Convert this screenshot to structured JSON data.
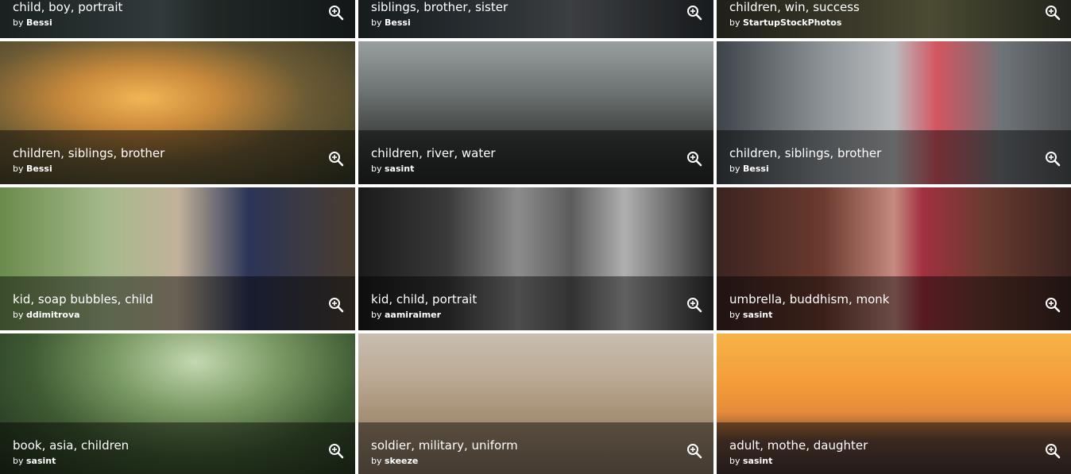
{
  "gallery": {
    "tiles": [
      {
        "tags": "child, boy, portrait",
        "by": "by ",
        "author": "Bessi",
        "bg": "linear-gradient(90deg,#2f3b3a 0%,#5b6a6d 45%,#3b4745 60%,#222b2d 100%)"
      },
      {
        "tags": "siblings, brother, sister",
        "by": "by ",
        "author": "Bessi",
        "bg": "linear-gradient(90deg,#2a3238 0%,#4f5a60 40%,#6e7377 60%,#2c3135 100%)"
      },
      {
        "tags": "children, win, success",
        "by": "by ",
        "author": "StartupStockPhotos",
        "bg": "linear-gradient(90deg,#3b3a2e 0%,#6c6a4d 40%,#8a8a5c 60%,#3c4033 100%)"
      },
      {
        "tags": "children, siblings, brother",
        "by": "by ",
        "author": "Bessi",
        "bg": "radial-gradient(ellipse at 40% 40%,#f3b655 0%,#c98a3c 25%,#6b5a34 55%,#2f3424 100%)"
      },
      {
        "tags": "children, river, water",
        "by": "by ",
        "author": "sasint",
        "bg": "linear-gradient(180deg,#9aa0a0 0%,#6d7372 35%,#3a3e3c 70%,#232624 100%)"
      },
      {
        "tags": "children, siblings, brother",
        "by": "by ",
        "author": "Bessi",
        "bg": "linear-gradient(90deg,#3d4348 0%,#8c9296 30%,#b9bcbf 50%,#d35560 62%,#6f7478 80%,#4b4f52 100%)"
      },
      {
        "tags": "kid, soap bubbles, child",
        "by": "by ",
        "author": "ddimitrova",
        "bg": "linear-gradient(90deg,#6a8b4c 0%,#a6b98b 30%,#c2b29a 50%,#2b3557 70%,#4a3d30 100%)"
      },
      {
        "tags": "kid, child, portrait",
        "by": "by ",
        "author": "aamiraimer",
        "bg": "linear-gradient(90deg,#1a1a1a 0%,#3a3a3a 25%,#8c8c8c 45%,#5c5c5c 60%,#b0b0b0 75%,#2e2e2e 100%)"
      },
      {
        "tags": "umbrella, buddhism, monk",
        "by": "by ",
        "author": "sasint",
        "bg": "linear-gradient(90deg,#3b2420 0%,#6b3a2e 30%,#c58a80 50%,#a23040 58%,#6a3b30 75%,#3a2420 100%)"
      },
      {
        "tags": "book, asia, children",
        "by": "by ",
        "author": "sasint",
        "bg": "radial-gradient(ellipse at 55% 20%,#c4d8b2 0%,#7a9a63 30%,#3e5a33 60%,#1e2a1a 100%)"
      },
      {
        "tags": "soldier, military, uniform",
        "by": "by ",
        "author": "skeeze",
        "bg": "linear-gradient(180deg,#c9bdb0 0%,#bcaa95 30%,#a48e74 60%,#7b6a58 100%)"
      },
      {
        "tags": "adult, mothe, daughter",
        "by": "by ",
        "author": "sasint",
        "bg": "linear-gradient(180deg,#f6b347 0%,#f39c3a 35%,#e58b3a 55%,#6a4a3a 75%,#3c3030 100%)"
      }
    ]
  },
  "icons": {
    "zoom": "zoom-in-icon"
  }
}
